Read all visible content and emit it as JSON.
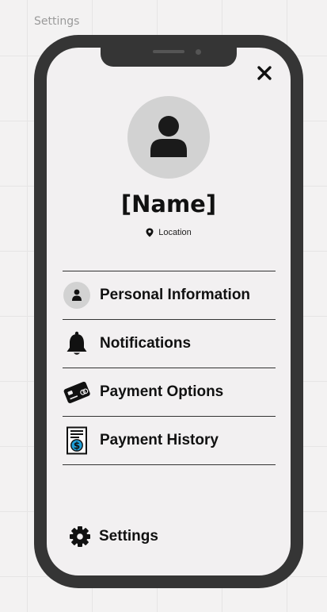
{
  "canvas": {
    "frame_label": "Settings"
  },
  "profile": {
    "name": "[Name]",
    "location": "Location",
    "avatar_icon": "user-icon"
  },
  "menu": {
    "items": [
      {
        "label": "Personal Information",
        "icon": "user-circle-icon"
      },
      {
        "label": "Notifications",
        "icon": "bell-icon"
      },
      {
        "label": "Payment Options",
        "icon": "credit-card-icon"
      },
      {
        "label": "Payment History",
        "icon": "receipt-dollar-icon"
      }
    ]
  },
  "footer": {
    "settings_label": "Settings",
    "icon": "gear-icon"
  },
  "colors": {
    "phone_frame": "#353535",
    "screen_bg": "#f2f0f1",
    "avatar_bg": "#d2d2d2",
    "dollar_blue": "#1e9fd8"
  }
}
